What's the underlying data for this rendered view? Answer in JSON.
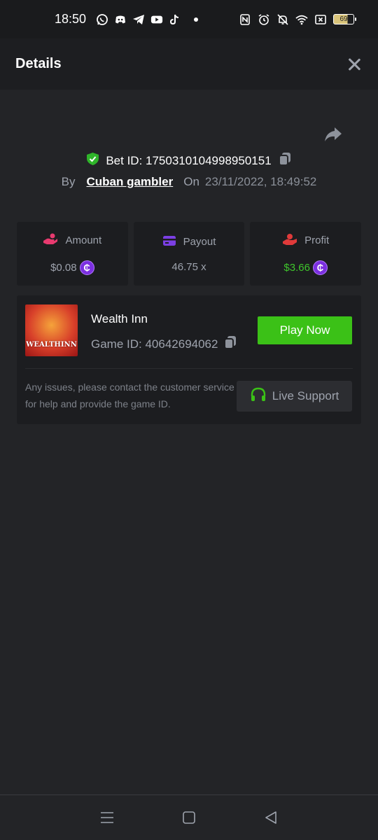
{
  "status_bar": {
    "time": "18:50",
    "battery": "69",
    "app_icons": [
      "whatsapp-icon",
      "discord-icon",
      "telegram-icon",
      "youtube-icon",
      "tiktok-icon"
    ],
    "system_icons": [
      "nfc-icon",
      "alarm-icon",
      "mute-icon",
      "wifi-icon",
      "close-box-icon",
      "battery-icon"
    ]
  },
  "header": {
    "title": "Details"
  },
  "bet": {
    "bet_id_label": "Bet ID: 1750310104998950151",
    "by_label": "By",
    "user": "Cuban gambler",
    "on_label": "On",
    "datetime": "23/11/2022, 18:49:52"
  },
  "stats": [
    {
      "label": "Amount",
      "value": "$0.08",
      "icon": "hand-coin-icon",
      "coin": true
    },
    {
      "label": "Payout",
      "value": "46.75 x",
      "icon": "card-icon",
      "coin": false
    },
    {
      "label": "Profit",
      "value": "$3.66",
      "icon": "profit-hand-icon",
      "coin": true
    }
  ],
  "coin_symbol": "₵",
  "game": {
    "name": "Wealth Inn",
    "game_id_label": "Game ID: 40642694062",
    "thumb_text": "WEALTHINN",
    "play_label": "Play Now",
    "issues_text": "Any issues, please contact the customer service for help and provide the game ID.",
    "support_label": "Live Support"
  },
  "colors": {
    "accent_green": "#3bc117",
    "profit_green": "#3fc52c",
    "coin_purple": "#7b2fe0",
    "amount_icon": "#e83a6f",
    "payout_icon": "#7b3fe4",
    "profit_icon": "#e03a3a"
  }
}
